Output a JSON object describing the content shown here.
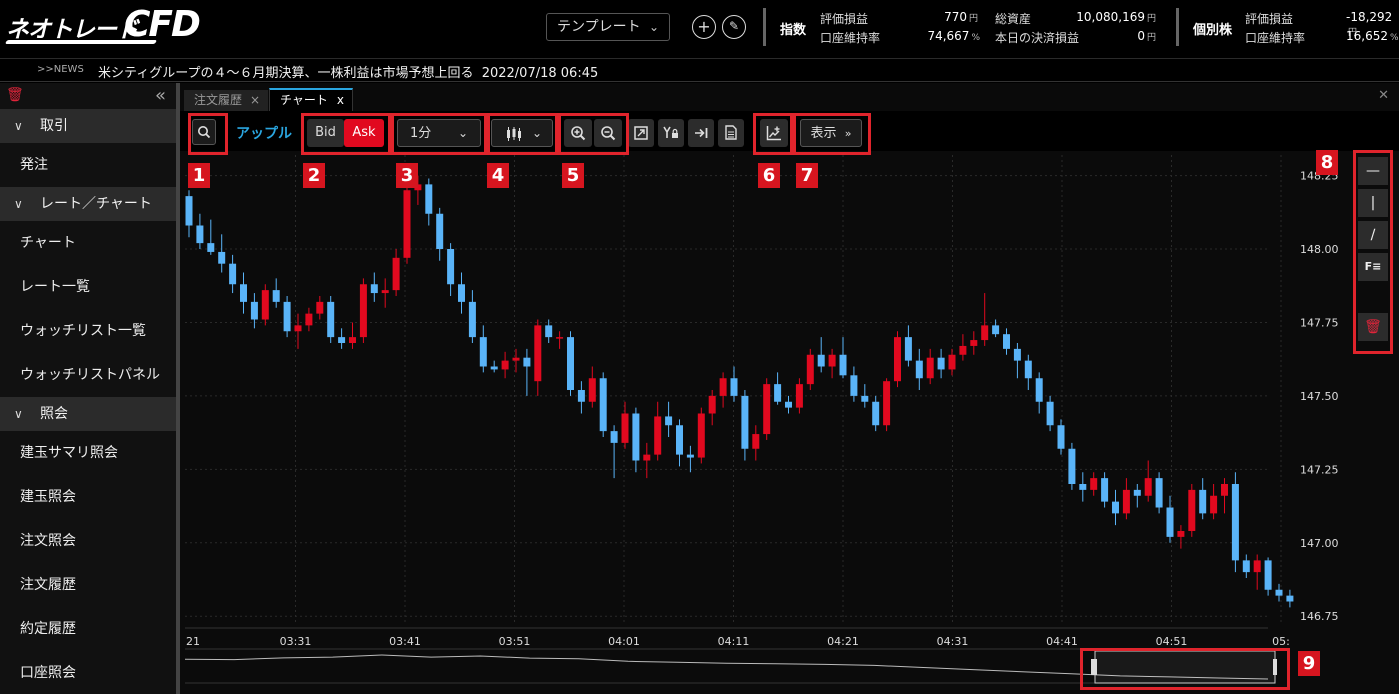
{
  "header": {
    "logo_text_jp": "ネオトレード",
    "logo_text_en": "CFD",
    "template_label": "テンプレート",
    "index_label": "指数",
    "index": {
      "unrealized_pl_label": "評価損益",
      "unrealized_pl_value": "770",
      "margin_ratio_label": "口座維持率",
      "margin_ratio_value": "74,667",
      "total_assets_label": "総資産",
      "total_assets_value": "10,080,169",
      "today_settle_label": "本日の決済損益",
      "today_settle_value": "0"
    },
    "stock_label": "個別株",
    "stock": {
      "unrealized_pl_label": "評価損益",
      "unrealized_pl_value": "-18,292",
      "margin_ratio_label": "口座維持率",
      "margin_ratio_value": "16,652"
    },
    "unit_yen": "円",
    "unit_pct": "%"
  },
  "news": {
    "tag": ">>NEWS",
    "headline": "米シティグループの４～６月期決算、一株利益は市場予想上回る",
    "datetime": "2022/07/18 06:45"
  },
  "sidebar": {
    "sections": [
      {
        "label": "取引",
        "items": [
          "発注"
        ]
      },
      {
        "label": "レート／チャート",
        "items": [
          "チャート",
          "レート一覧",
          "ウォッチリスト一覧",
          "ウォッチリストパネル"
        ]
      },
      {
        "label": "照会",
        "items": [
          "建玉サマリ照会",
          "建玉照会",
          "注文照会",
          "注文履歴",
          "約定履歴",
          "口座照会"
        ]
      }
    ]
  },
  "tabs": [
    {
      "label": "注文履歴",
      "close": "×"
    },
    {
      "label": "チャート",
      "close": "x"
    }
  ],
  "toolbar": {
    "symbol": "アップル",
    "bid_label": "Bid",
    "ask_label": "Ask",
    "interval": "1分",
    "display_label": "表示"
  },
  "badges": [
    "1",
    "2",
    "3",
    "4",
    "5",
    "6",
    "7",
    "8",
    "9"
  ],
  "colors": {
    "up": "#e1091f",
    "down": "#5ab4f8",
    "accent": "#2aa6e0",
    "annotation": "#e0242c"
  },
  "chart_data": {
    "type": "candlestick",
    "ylim": [
      146.72,
      148.32
    ],
    "yticks": [
      "148.25",
      "148.00",
      "147.75",
      "147.50",
      "147.25",
      "147.00",
      "146.75"
    ],
    "ytick_values": [
      148.25,
      148.0,
      147.75,
      147.5,
      147.25,
      147.0,
      146.75
    ],
    "xticks": [
      "21",
      "03:31",
      "03:41",
      "03:51",
      "04:01",
      "04:11",
      "04:21",
      "04:31",
      "04:41",
      "04:51",
      "05:"
    ],
    "candles": [
      [
        148.18,
        148.2,
        148.04,
        148.08
      ],
      [
        148.08,
        148.12,
        148.0,
        148.02
      ],
      [
        148.02,
        148.1,
        147.98,
        147.99
      ],
      [
        147.99,
        148.05,
        147.92,
        147.95
      ],
      [
        147.95,
        147.98,
        147.85,
        147.88
      ],
      [
        147.88,
        147.92,
        147.78,
        147.82
      ],
      [
        147.82,
        147.85,
        147.73,
        147.76
      ],
      [
        147.76,
        147.88,
        147.74,
        147.86
      ],
      [
        147.86,
        147.9,
        147.8,
        147.82
      ],
      [
        147.82,
        147.84,
        147.7,
        147.72
      ],
      [
        147.72,
        147.78,
        147.66,
        147.74
      ],
      [
        147.74,
        147.8,
        147.72,
        147.78
      ],
      [
        147.78,
        147.84,
        147.76,
        147.82
      ],
      [
        147.82,
        147.84,
        147.68,
        147.7
      ],
      [
        147.7,
        147.73,
        147.66,
        147.68
      ],
      [
        147.68,
        147.75,
        147.66,
        147.7
      ],
      [
        147.7,
        147.9,
        147.68,
        147.88
      ],
      [
        147.88,
        147.92,
        147.82,
        147.85
      ],
      [
        147.85,
        147.9,
        147.8,
        147.86
      ],
      [
        147.86,
        148.0,
        147.84,
        147.97
      ],
      [
        147.97,
        148.22,
        147.95,
        148.2
      ],
      [
        148.2,
        148.25,
        148.15,
        148.22
      ],
      [
        148.22,
        148.24,
        148.08,
        148.12
      ],
      [
        148.12,
        148.14,
        147.96,
        148.0
      ],
      [
        148.0,
        148.02,
        147.84,
        147.88
      ],
      [
        147.88,
        147.92,
        147.78,
        147.82
      ],
      [
        147.82,
        147.86,
        147.68,
        147.7
      ],
      [
        147.7,
        147.74,
        147.58,
        147.6
      ],
      [
        147.6,
        147.62,
        147.58,
        147.59
      ],
      [
        147.59,
        147.65,
        147.56,
        147.62
      ],
      [
        147.62,
        147.66,
        147.58,
        147.63
      ],
      [
        147.63,
        147.66,
        147.5,
        147.6
      ],
      [
        147.55,
        147.76,
        147.5,
        147.74
      ],
      [
        147.74,
        147.76,
        147.68,
        147.7
      ],
      [
        147.7,
        147.72,
        147.66,
        147.7
      ],
      [
        147.7,
        147.72,
        147.5,
        147.52
      ],
      [
        147.52,
        147.55,
        147.44,
        147.48
      ],
      [
        147.48,
        147.6,
        147.46,
        147.56
      ],
      [
        147.56,
        147.58,
        147.36,
        147.38
      ],
      [
        147.38,
        147.4,
        147.22,
        147.34
      ],
      [
        147.34,
        147.48,
        147.32,
        147.44
      ],
      [
        147.44,
        147.46,
        147.24,
        147.28
      ],
      [
        147.28,
        147.34,
        147.22,
        147.3
      ],
      [
        147.3,
        147.48,
        147.28,
        147.43
      ],
      [
        147.43,
        147.48,
        147.36,
        147.4
      ],
      [
        147.4,
        147.42,
        147.26,
        147.3
      ],
      [
        147.3,
        147.33,
        147.24,
        147.29
      ],
      [
        147.29,
        147.46,
        147.27,
        147.44
      ],
      [
        147.44,
        147.52,
        147.4,
        147.5
      ],
      [
        147.5,
        147.58,
        147.46,
        147.56
      ],
      [
        147.56,
        147.6,
        147.48,
        147.5
      ],
      [
        147.5,
        147.52,
        147.28,
        147.32
      ],
      [
        147.32,
        147.4,
        147.28,
        147.37
      ],
      [
        147.37,
        147.56,
        147.35,
        147.54
      ],
      [
        147.54,
        147.58,
        147.47,
        147.48
      ],
      [
        147.48,
        147.5,
        147.44,
        147.46
      ],
      [
        147.46,
        147.56,
        147.44,
        147.54
      ],
      [
        147.54,
        147.66,
        147.52,
        147.64
      ],
      [
        147.64,
        147.7,
        147.58,
        147.6
      ],
      [
        147.6,
        147.66,
        147.56,
        147.64
      ],
      [
        147.64,
        147.7,
        147.56,
        147.57
      ],
      [
        147.57,
        147.6,
        147.48,
        147.5
      ],
      [
        147.5,
        147.54,
        147.46,
        147.48
      ],
      [
        147.48,
        147.5,
        147.38,
        147.4
      ],
      [
        147.4,
        147.56,
        147.38,
        147.55
      ],
      [
        147.55,
        147.72,
        147.53,
        147.7
      ],
      [
        147.7,
        147.74,
        147.6,
        147.62
      ],
      [
        147.62,
        147.66,
        147.52,
        147.56
      ],
      [
        147.56,
        147.66,
        147.54,
        147.63
      ],
      [
        147.63,
        147.66,
        147.56,
        147.59
      ],
      [
        147.59,
        147.66,
        147.57,
        147.64
      ],
      [
        147.64,
        147.71,
        147.62,
        147.67
      ],
      [
        147.67,
        147.72,
        147.64,
        147.69
      ],
      [
        147.69,
        147.85,
        147.67,
        147.74
      ],
      [
        147.74,
        147.76,
        147.7,
        147.71
      ],
      [
        147.71,
        147.73,
        147.64,
        147.66
      ],
      [
        147.66,
        147.68,
        147.56,
        147.62
      ],
      [
        147.62,
        147.64,
        147.52,
        147.56
      ],
      [
        147.56,
        147.58,
        147.44,
        147.48
      ],
      [
        147.48,
        147.5,
        147.38,
        147.4
      ],
      [
        147.4,
        147.42,
        147.3,
        147.32
      ],
      [
        147.32,
        147.34,
        147.18,
        147.2
      ],
      [
        147.2,
        147.24,
        147.14,
        147.18
      ],
      [
        147.18,
        147.24,
        147.16,
        147.22
      ],
      [
        147.22,
        147.24,
        147.12,
        147.14
      ],
      [
        147.14,
        147.18,
        147.06,
        147.1
      ],
      [
        147.1,
        147.22,
        147.08,
        147.18
      ],
      [
        147.18,
        147.2,
        147.12,
        147.16
      ],
      [
        147.16,
        147.28,
        147.14,
        147.22
      ],
      [
        147.22,
        147.24,
        147.1,
        147.12
      ],
      [
        147.12,
        147.16,
        147.0,
        147.02
      ],
      [
        147.02,
        147.06,
        146.98,
        147.04
      ],
      [
        147.04,
        147.2,
        147.02,
        147.18
      ],
      [
        147.18,
        147.22,
        147.08,
        147.1
      ],
      [
        147.1,
        147.2,
        147.08,
        147.16
      ],
      [
        147.16,
        147.22,
        147.1,
        147.2
      ],
      [
        147.2,
        147.24,
        146.9,
        146.94
      ],
      [
        146.94,
        146.96,
        146.88,
        146.9
      ],
      [
        146.9,
        146.96,
        146.84,
        146.94
      ],
      [
        146.94,
        146.95,
        146.82,
        146.84
      ],
      [
        146.84,
        146.86,
        146.8,
        146.82
      ],
      [
        146.82,
        146.84,
        146.78,
        146.8
      ]
    ],
    "navigator_values": [
      147.8,
      147.78,
      147.86,
      147.9,
      148.0,
      147.9,
      147.95,
      147.85,
      147.82,
      147.7,
      147.65,
      147.6,
      147.58,
      147.55,
      147.5,
      147.4,
      147.3,
      147.2,
      147.1,
      147.0,
      146.95,
      146.9,
      146.85
    ]
  }
}
